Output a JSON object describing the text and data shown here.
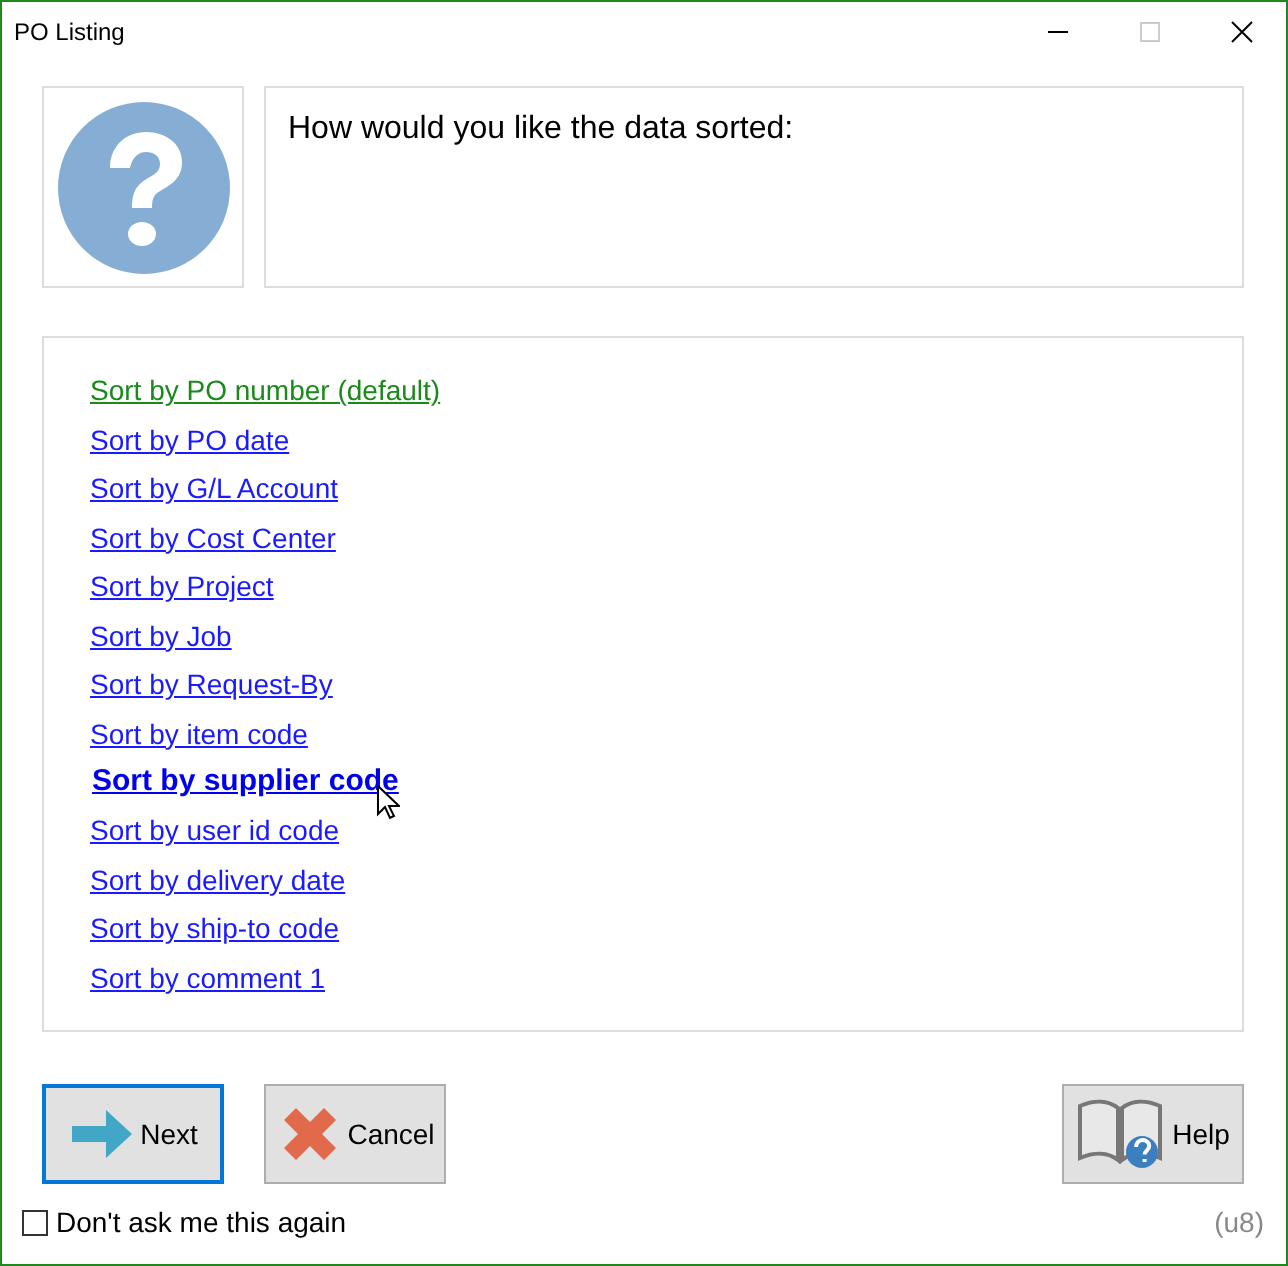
{
  "window": {
    "title": "PO Listing"
  },
  "prompt": "How would you like the data sorted:",
  "options": [
    {
      "label": "Sort by PO number (default)",
      "default": true,
      "hovered": false
    },
    {
      "label": "Sort by PO date",
      "default": false,
      "hovered": false
    },
    {
      "label": "Sort by G/L Account",
      "default": false,
      "hovered": false
    },
    {
      "label": "Sort by Cost Center",
      "default": false,
      "hovered": false
    },
    {
      "label": "Sort by Project",
      "default": false,
      "hovered": false
    },
    {
      "label": "Sort by Job",
      "default": false,
      "hovered": false
    },
    {
      "label": "Sort by Request-By",
      "default": false,
      "hovered": false
    },
    {
      "label": "Sort by item code",
      "default": false,
      "hovered": false
    },
    {
      "label": "Sort by supplier code",
      "default": false,
      "hovered": true
    },
    {
      "label": "Sort by user id code",
      "default": false,
      "hovered": false
    },
    {
      "label": "Sort by delivery date",
      "default": false,
      "hovered": false
    },
    {
      "label": "Sort by ship-to code",
      "default": false,
      "hovered": false
    },
    {
      "label": "Sort by comment 1",
      "default": false,
      "hovered": false
    }
  ],
  "buttons": [
    {
      "kind": "next",
      "label": "Next",
      "focused": true
    },
    {
      "kind": "cancel",
      "label": "Cancel",
      "focused": false
    },
    {
      "kind": "help",
      "label": "Help",
      "focused": false
    }
  ],
  "dont_ask": {
    "label": "Don't ask me this again",
    "checked": false
  },
  "version": "(u8)"
}
